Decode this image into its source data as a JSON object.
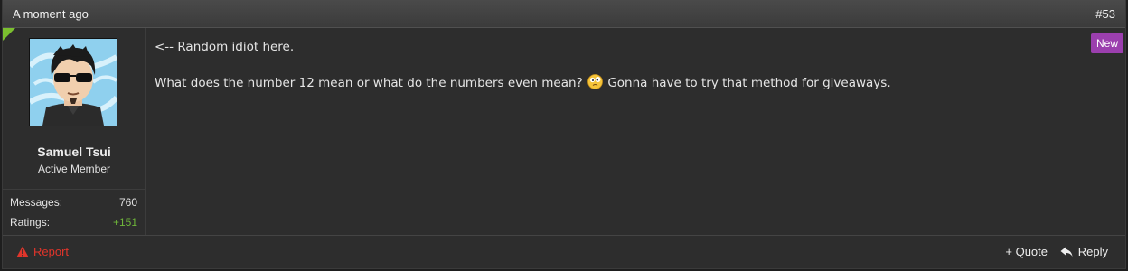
{
  "header": {
    "timestamp": "A moment ago",
    "post_number": "#53"
  },
  "user": {
    "name": "Samuel Tsui",
    "title": "Active Member",
    "avatar_icon": "avatar-cartoon-man-sunglasses",
    "stats": [
      {
        "label": "Messages:",
        "value": "760"
      },
      {
        "label": "Ratings:",
        "value": "+151"
      }
    ]
  },
  "post": {
    "line1": "<-- Random idiot here.",
    "line2_before": "What does the number 12 mean or what do the numbers even mean?",
    "emoji": "confused-face-icon",
    "line2_after": "Gonna have to try that method for giveaways.",
    "badge": "New"
  },
  "footer": {
    "report_label": "Report",
    "quote_label": "+ Quote",
    "reply_label": "Reply"
  },
  "colors": {
    "report": "#e0352b",
    "positive": "#6fb73a",
    "badge": "#9b3fae",
    "corner": "#7bbf2f"
  }
}
